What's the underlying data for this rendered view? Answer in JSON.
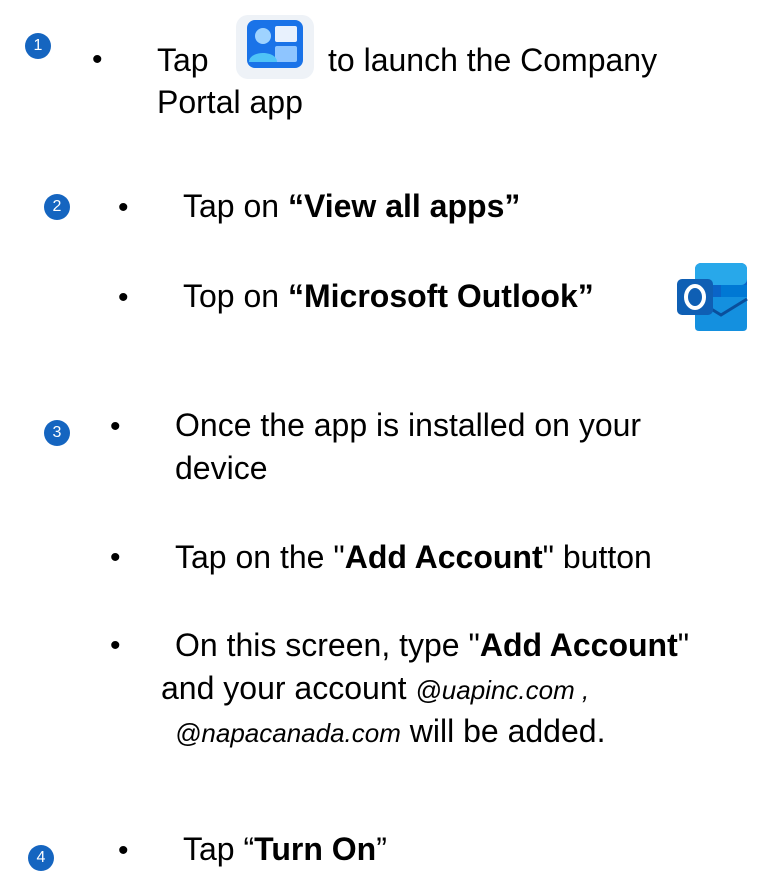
{
  "step1": {
    "badge": "1",
    "bullet": "•",
    "tap": "Tap",
    "after_icon": "to launch the Company",
    "line2": "Portal app",
    "icon": "company-portal-icon",
    "icon_colors": {
      "bg": "#1a73e8",
      "tile": "#ffffff"
    }
  },
  "step2": {
    "badge": "2",
    "items": [
      {
        "bullet": "•",
        "prefix": "Tap on ",
        "bold": "“View all apps”"
      },
      {
        "bullet": "•",
        "prefix": "Top on ",
        "bold": "“Microsoft Outlook”",
        "icon": "outlook-icon"
      }
    ]
  },
  "step3": {
    "badge": "3",
    "item1": {
      "bullet": "•",
      "line1": "Once the app is installed on your",
      "line2": "device"
    },
    "item2": {
      "bullet": "•",
      "prefix": "Tap on the \"",
      "bold": "Add Account",
      "suffix": "\" button"
    },
    "item3": {
      "bullet": "•",
      "prefix": "On this screen, type \"",
      "bold": "Add Account",
      "suffix": "\"",
      "line2_prefix": "and your account ",
      "line2_italic": "@uapinc.com ,",
      "line3_italic": "@napacanada.com",
      "line3_suffix": " will be added."
    }
  },
  "step4": {
    "badge": "4",
    "bullet": "•",
    "prefix": "Tap “",
    "bold": "Turn On",
    "suffix": "”"
  },
  "colors": {
    "badge": "#1565c0",
    "outlook_blue": "#0a64c8"
  }
}
